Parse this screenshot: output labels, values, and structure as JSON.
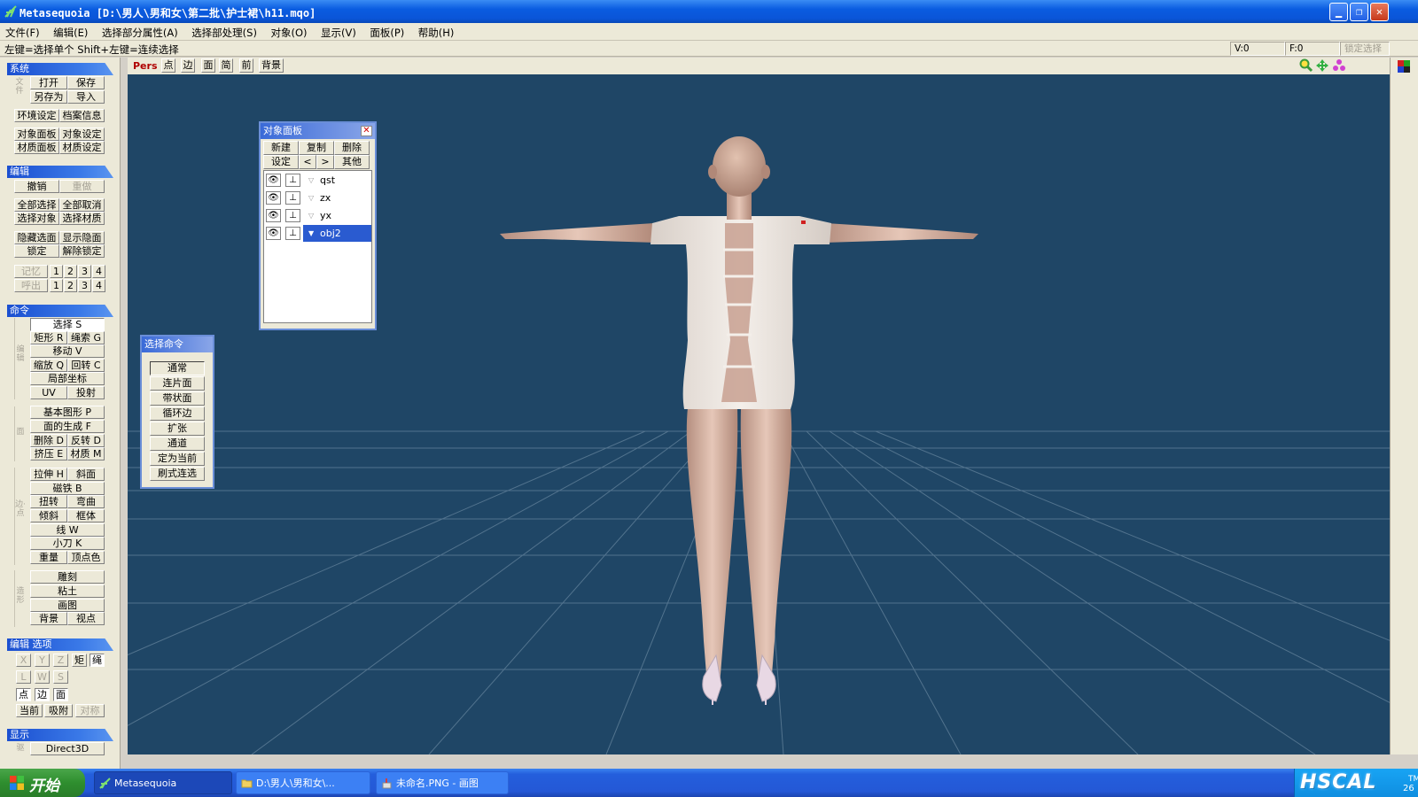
{
  "window": {
    "title": "Metasequoia [D:\\男人\\男和女\\第二批\\护士裙\\h11.mqo]",
    "controls": [
      "minimize",
      "maximize",
      "close"
    ]
  },
  "menu": [
    "文件(F)",
    "编辑(E)",
    "选择部分属性(A)",
    "选择部处理(S)",
    "对象(O)",
    "显示(V)",
    "面板(P)",
    "帮助(H)"
  ],
  "status": {
    "hint": "左键=选择单个  Shift+左键=连续选择",
    "v": "V:0",
    "f": "F:0",
    "lock": "锁定选择"
  },
  "left_panel": {
    "system": {
      "title": "系统",
      "side": "文件",
      "open": "打开",
      "save": "保存",
      "save_as": "另存为",
      "import": "导入",
      "env": "环境设定",
      "info": "档案信息",
      "obj_panel": "对象面板",
      "obj_set": "对象设定",
      "mat_panel": "材质面板",
      "mat_set": "材质设定"
    },
    "edit": {
      "title": "编辑",
      "undo": "撤销",
      "redo": "重做",
      "select_all": "全部选择",
      "deselect_all": "全部取消",
      "select_obj": "选择对象",
      "select_mat": "选择材质",
      "hide_sel": "隐藏选面",
      "show_hidden": "显示隐面",
      "lock": "锁定",
      "unlock": "解除锁定",
      "memo": "记忆",
      "recall": "呼出",
      "slots": [
        "1",
        "2",
        "3",
        "4"
      ]
    },
    "command": {
      "title": "命令",
      "side1": "编辑",
      "select": "选择 S",
      "rect": "矩形 R",
      "rope": "绳索 G",
      "move": "移动 V",
      "scale": "缩放 Q",
      "rotate": "回转 C",
      "local": "局部坐标",
      "uv": "UV",
      "project": "投射",
      "side2": "面",
      "primitive": "基本图形 P",
      "face_gen": "面的生成 F",
      "delete": "删除 D",
      "flip": "反转 D",
      "extrude": "挤压 E",
      "material": "材质 M",
      "side3": "边·点",
      "stretch": "拉伸 H",
      "bevel": "斜面",
      "magnet": "磁铁 B",
      "twist": "扭转",
      "bend": "弯曲",
      "tilt": "倾斜",
      "lattice": "框体",
      "line": "线 W",
      "knife": "小刀 K",
      "weight": "重量",
      "vcolor": "顶点色",
      "side4": "造形",
      "sculpt": "雕刻",
      "clay": "粘土",
      "paint": "画图",
      "background": "背景",
      "viewpoint": "视点"
    },
    "edit_options": {
      "title": "编辑 选项",
      "x": "X",
      "y": "Y",
      "z": "Z",
      "rect": "矩",
      "rope": "绳",
      "l": "L",
      "w": "W",
      "s": "S",
      "point": "点",
      "edge": "边",
      "face": "面",
      "current": "当前",
      "snap": "吸附",
      "symmetry": "对称"
    },
    "display": {
      "title": "显示",
      "side": "驱",
      "renderer": "Direct3D"
    }
  },
  "view_toolbar": {
    "mode": "Pers",
    "buttons": [
      "点",
      "边",
      "面",
      "简",
      "前",
      "背景"
    ]
  },
  "object_panel": {
    "title": "对象面板",
    "new": "新建",
    "copy": "复制",
    "delete": "删除",
    "settings": "设定",
    "prev": "<",
    "next": ">",
    "other": "其他",
    "objects": [
      {
        "name": "qst",
        "selected": false
      },
      {
        "name": "zx",
        "selected": false
      },
      {
        "name": "yx",
        "selected": false
      },
      {
        "name": "obj2",
        "selected": true
      }
    ]
  },
  "select_panel": {
    "title": "选择命令",
    "items": [
      "通常",
      "连片面",
      "带状面",
      "循环边",
      "扩张",
      "通道",
      "定为当前",
      "刷式连选"
    ],
    "selected_index": 0
  },
  "taskbar": {
    "start": "开始",
    "tasks": [
      {
        "label": "Metasequoia",
        "active": true
      },
      {
        "label": "D:\\男人\\男和女\\...",
        "active": false
      },
      {
        "label": "未命名.PNG - 画图",
        "active": false
      }
    ],
    "tray_logo": "HSCAL",
    "tray_tm": "TM",
    "tray_text": "26"
  },
  "colors": {
    "viewport_bg": "#1f4666",
    "grid": "#6f8aa0",
    "selection": "#2a5bd0",
    "title_bar": "#0a5ce0"
  }
}
